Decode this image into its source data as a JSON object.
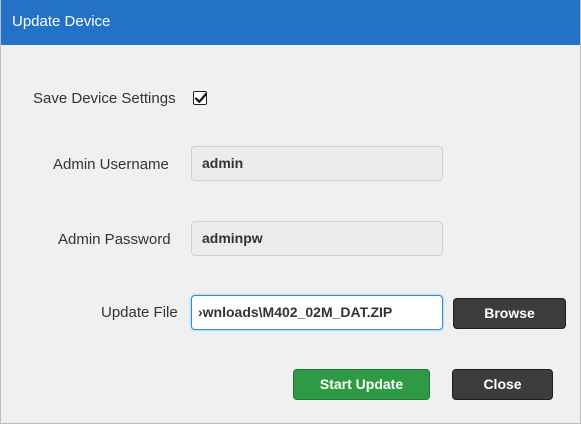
{
  "window": {
    "title": "Update Device"
  },
  "form": {
    "save_settings_label": "Save Device Settings",
    "save_settings_checked": true,
    "admin_username_label": "Admin Username",
    "admin_username_value": "admin",
    "admin_password_label": "Admin Password",
    "admin_password_value": "adminpw",
    "update_file_label": "Update File",
    "update_file_value": "›wnloads\\M402_02M_DAT.ZIP"
  },
  "buttons": {
    "browse_label": "Browse",
    "start_update_label": "Start Update",
    "close_label": "Close"
  },
  "colors": {
    "titlebar": "#2472c8",
    "primary_button": "#2e9a45",
    "dark_button": "#3c3c3c",
    "focus_border": "#2e8fd3"
  }
}
